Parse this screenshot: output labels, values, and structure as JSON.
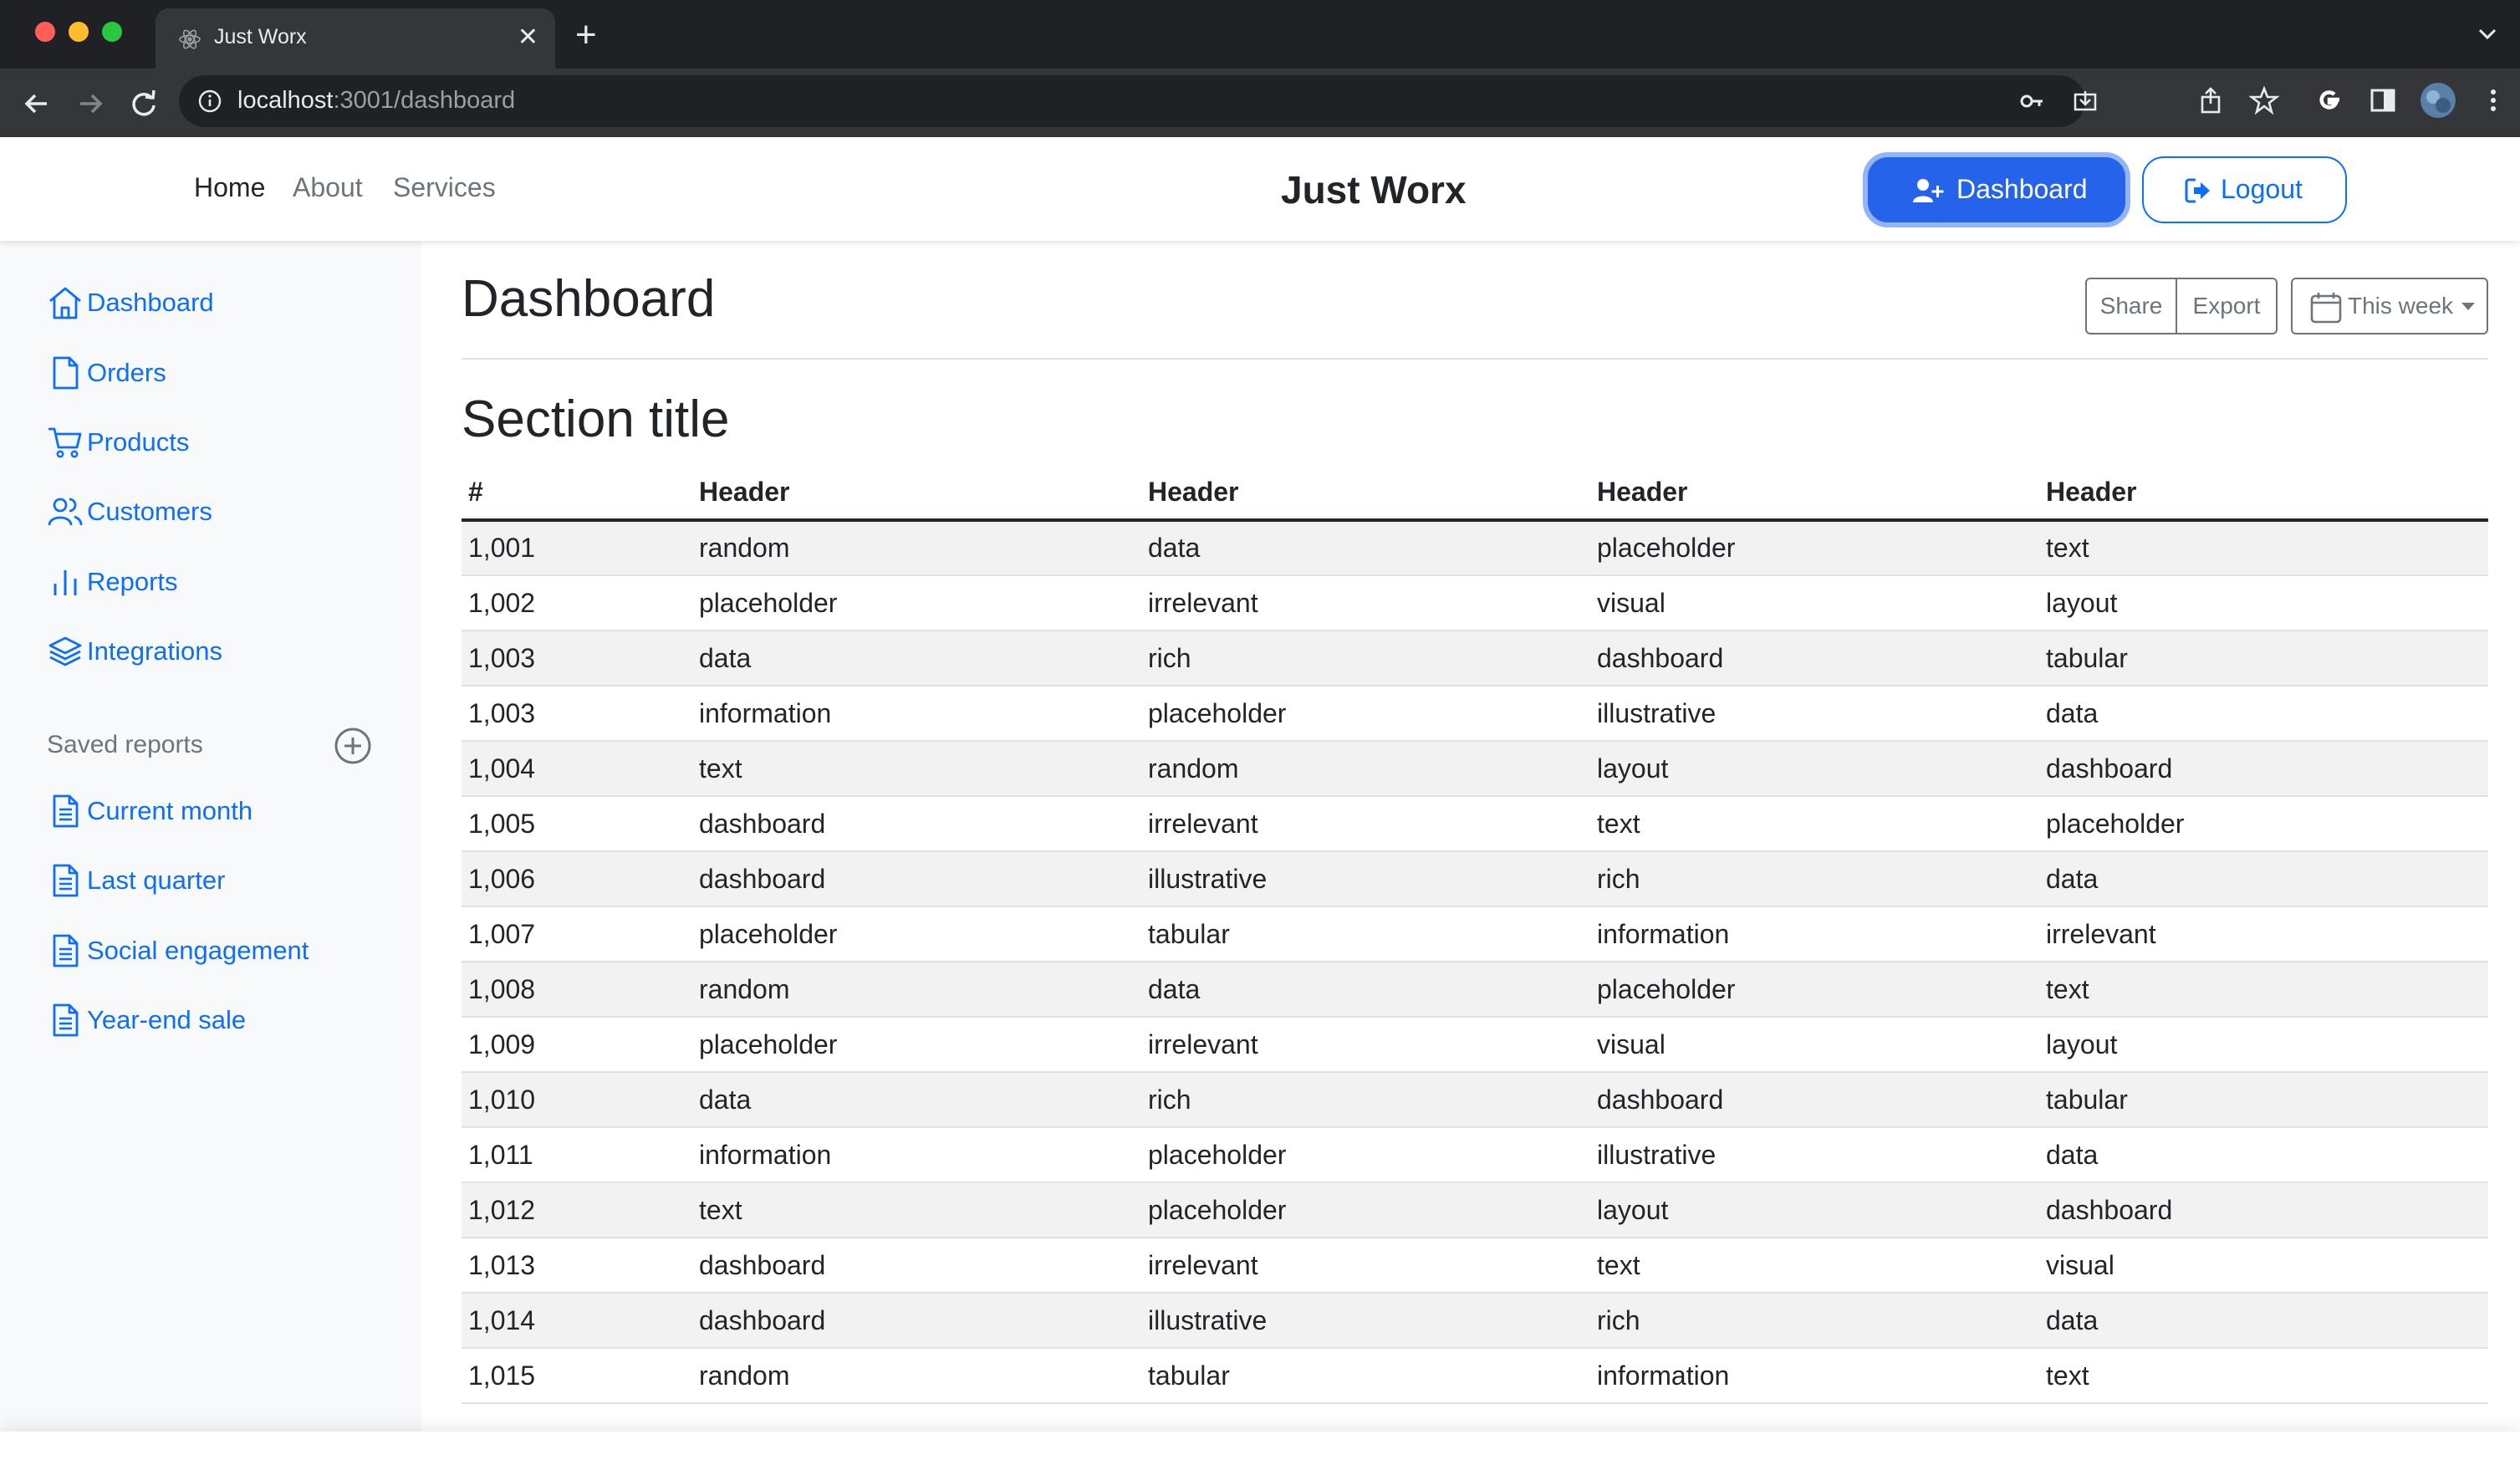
{
  "browser": {
    "tab_title": "Just Worx",
    "url_host": "localhost",
    "url_path": ":3001/dashboard"
  },
  "navbar": {
    "links": [
      "Home",
      "About",
      "Services"
    ],
    "brand": "Just Worx",
    "dashboard_button": "Dashboard",
    "logout_button": "Logout"
  },
  "sidebar": {
    "items": [
      {
        "label": "Dashboard",
        "icon": "home-icon"
      },
      {
        "label": "Orders",
        "icon": "file-icon"
      },
      {
        "label": "Products",
        "icon": "cart-icon"
      },
      {
        "label": "Customers",
        "icon": "users-icon"
      },
      {
        "label": "Reports",
        "icon": "bar-chart-icon"
      },
      {
        "label": "Integrations",
        "icon": "layers-icon"
      }
    ],
    "saved_heading": "Saved reports",
    "saved_items": [
      "Current month",
      "Last quarter",
      "Social engagement",
      "Year-end sale"
    ]
  },
  "main": {
    "title": "Dashboard",
    "share": "Share",
    "export": "Export",
    "period": "This week",
    "section_title": "Section title",
    "table": {
      "headers": [
        "#",
        "Header",
        "Header",
        "Header",
        "Header"
      ],
      "rows": [
        [
          "1,001",
          "random",
          "data",
          "placeholder",
          "text"
        ],
        [
          "1,002",
          "placeholder",
          "irrelevant",
          "visual",
          "layout"
        ],
        [
          "1,003",
          "data",
          "rich",
          "dashboard",
          "tabular"
        ],
        [
          "1,003",
          "information",
          "placeholder",
          "illustrative",
          "data"
        ],
        [
          "1,004",
          "text",
          "random",
          "layout",
          "dashboard"
        ],
        [
          "1,005",
          "dashboard",
          "irrelevant",
          "text",
          "placeholder"
        ],
        [
          "1,006",
          "dashboard",
          "illustrative",
          "rich",
          "data"
        ],
        [
          "1,007",
          "placeholder",
          "tabular",
          "information",
          "irrelevant"
        ],
        [
          "1,008",
          "random",
          "data",
          "placeholder",
          "text"
        ],
        [
          "1,009",
          "placeholder",
          "irrelevant",
          "visual",
          "layout"
        ],
        [
          "1,010",
          "data",
          "rich",
          "dashboard",
          "tabular"
        ],
        [
          "1,011",
          "information",
          "placeholder",
          "illustrative",
          "data"
        ],
        [
          "1,012",
          "text",
          "placeholder",
          "layout",
          "dashboard"
        ],
        [
          "1,013",
          "dashboard",
          "irrelevant",
          "text",
          "visual"
        ],
        [
          "1,014",
          "dashboard",
          "illustrative",
          "rich",
          "data"
        ],
        [
          "1,015",
          "random",
          "tabular",
          "information",
          "text"
        ]
      ]
    }
  },
  "colors": {
    "link": "#0d6efd",
    "primary_button": "#2563eb",
    "sidebar_bg": "#f8f9fa",
    "chrome_dark": "#202124"
  }
}
